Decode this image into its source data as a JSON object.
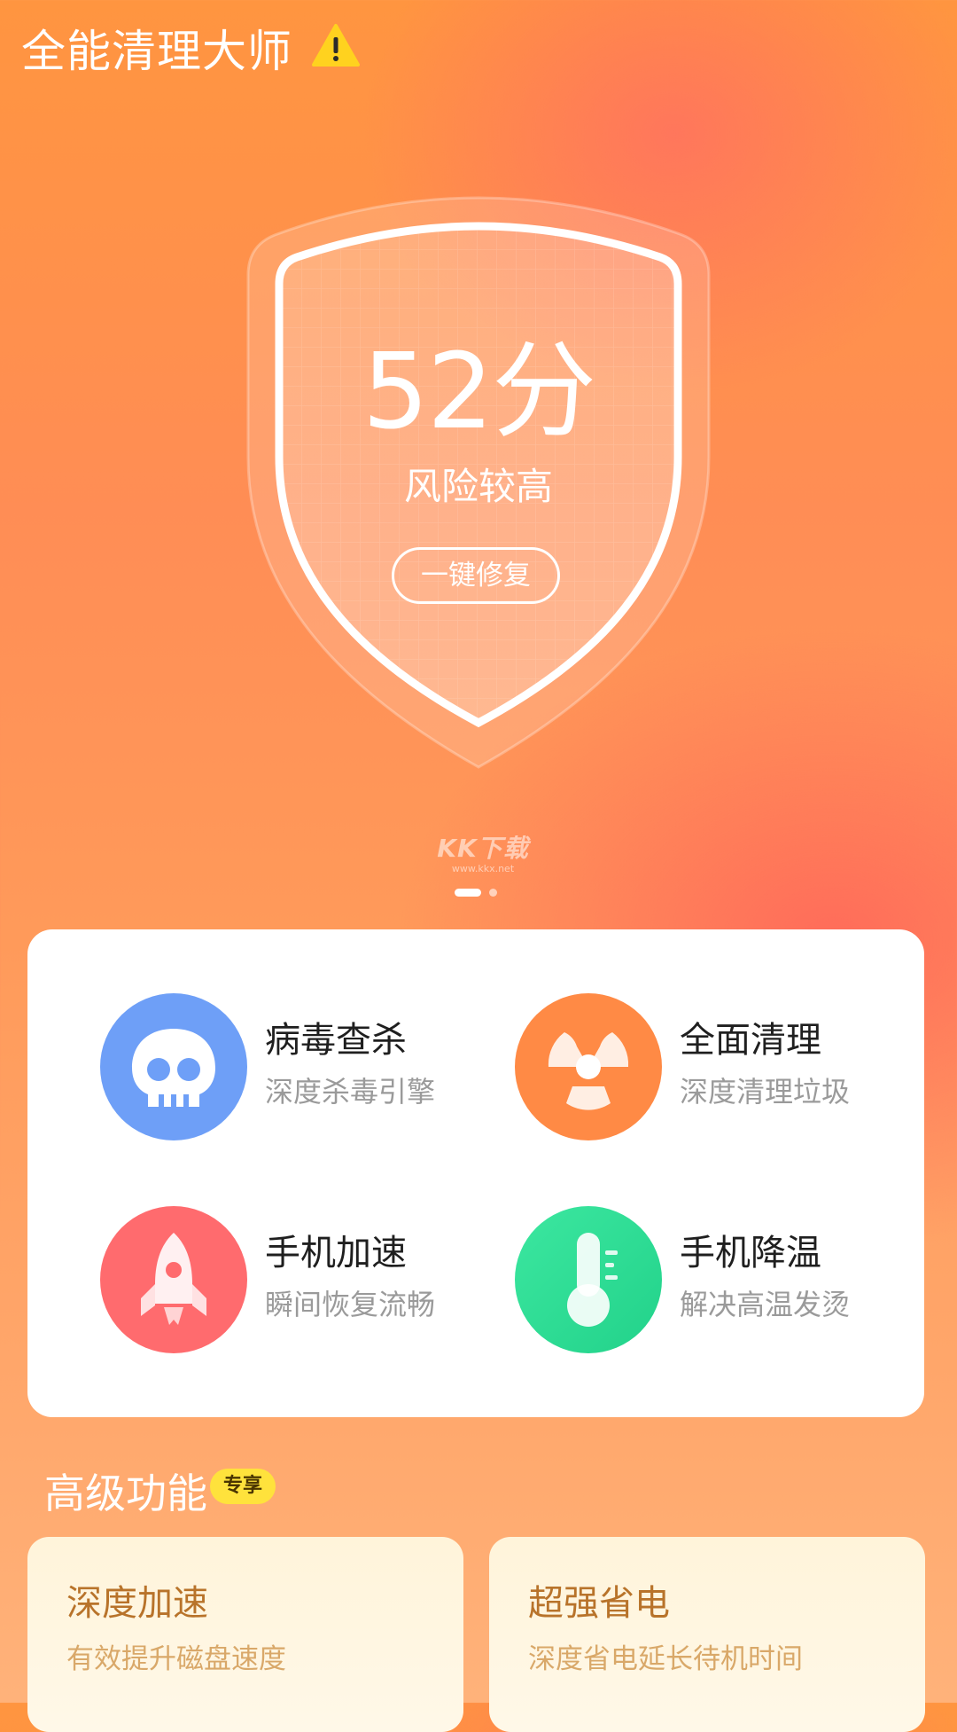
{
  "header": {
    "title": "全能清理大师",
    "alert_icon": "warning-icon"
  },
  "shield": {
    "score": "52分",
    "risk_text": "风险较高",
    "repair_button": "一键修复"
  },
  "watermark": {
    "brand": "KK下载",
    "url": "www.kkx.net"
  },
  "pager": {
    "current": 1,
    "total": 2
  },
  "features": [
    {
      "title": "病毒查杀",
      "subtitle": "深度杀毒引擎",
      "icon": "skull-icon",
      "color": "#6e9ff7"
    },
    {
      "title": "全面清理",
      "subtitle": "深度清理垃圾",
      "icon": "radiation-icon",
      "color": "#ff8a45"
    },
    {
      "title": "手机加速",
      "subtitle": "瞬间恢复流畅",
      "icon": "rocket-icon",
      "color": "#ff6b6e"
    },
    {
      "title": "手机降温",
      "subtitle": "解决高温发烫",
      "icon": "thermometer-icon",
      "color": "#2fd98e"
    }
  ],
  "advanced": {
    "title": "高级功能",
    "badge": "专享",
    "cards": [
      {
        "title": "深度加速",
        "subtitle": "有效提升磁盘速度"
      },
      {
        "title": "超强省电",
        "subtitle": "深度省电延长待机时间"
      }
    ]
  }
}
